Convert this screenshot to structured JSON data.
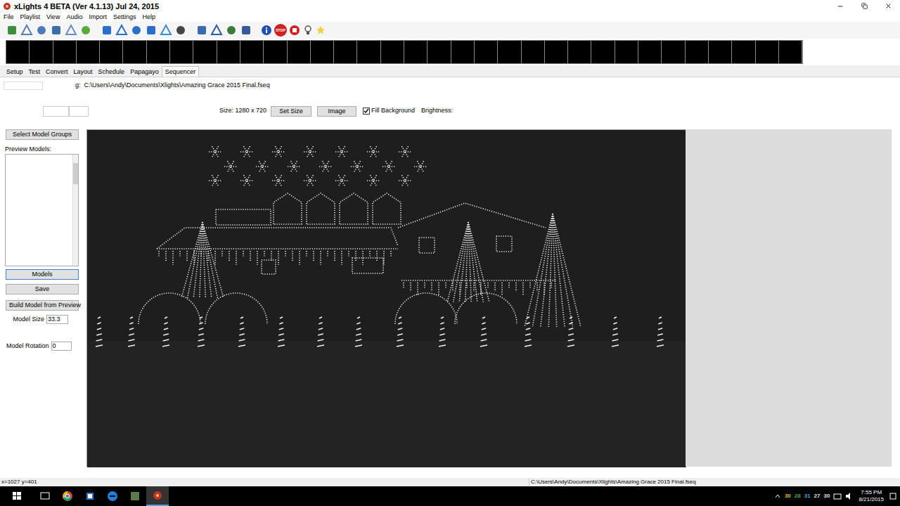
{
  "window": {
    "title": "xLights 4 BETA (Ver 4.1.13) Jul 24, 2015"
  },
  "menu": [
    "File",
    "Playlist",
    "View",
    "Audio",
    "Import",
    "Settings",
    "Help"
  ],
  "toolbar": {
    "stop_label": "STOP"
  },
  "tabs": [
    {
      "label": "Setup",
      "selected": false
    },
    {
      "label": "Test",
      "selected": false
    },
    {
      "label": "Convert",
      "selected": false
    },
    {
      "label": "Layout",
      "selected": false
    },
    {
      "label": "Schedule",
      "selected": false
    },
    {
      "label": "Papagayo",
      "selected": false
    },
    {
      "label": "Sequencer",
      "selected": true
    }
  ],
  "file_row": {
    "label": "g:",
    "path": "C:\\Users\\Andy\\Documents\\Xlights\\Amazing Grace 2015 Final.fseq"
  },
  "preview_controls": {
    "size": "Size: 1280 x 720",
    "set_size": "Set Size",
    "image": "Image",
    "fill_background": {
      "label": "Fill Background",
      "checked": true
    },
    "brightness": "Brightness:"
  },
  "sidebar": {
    "select_groups": "Select Model Groups",
    "preview_models_label": "Preview Models:",
    "preview_models": [],
    "buttons": [
      {
        "label": "Models",
        "selected": true
      },
      {
        "label": "Save",
        "selected": false
      }
    ],
    "build": "Build Model from Preview",
    "model_size": {
      "label": "Model Size",
      "value": "33.3"
    },
    "model_rotation": {
      "label": "Model Rotation",
      "value": "0"
    }
  },
  "status_bar": {
    "coords": "x=1027 y=401",
    "path": "C:\\Users\\Andy\\Documents\\Xlights\\Amazing Grace 2015 Final.fseq"
  },
  "taskbar": {
    "tray": [
      {
        "value": "30",
        "color": "#d9c21a"
      },
      {
        "value": "28",
        "color": "#3fae49"
      },
      {
        "value": "31",
        "color": "#4aa3df"
      },
      {
        "value": "27",
        "color": "#e0e0e0"
      },
      {
        "value": "30",
        "color": "#e0e0e0"
      }
    ],
    "time": "7:55 PM",
    "date": "8/21/2015"
  }
}
